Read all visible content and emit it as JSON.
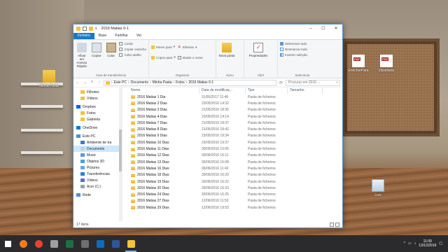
{
  "desktop": {
    "icons": [
      {
        "label": "Minha Pasta",
        "kind": "folder"
      },
      {
        "label": "EnricherPara",
        "kind": "pdf"
      },
      {
        "label": "Obsidiano",
        "kind": "pdf"
      },
      {
        "label": "Lixo",
        "kind": "bin"
      }
    ]
  },
  "window": {
    "title": "2016 Matias 0-1",
    "tabs": [
      "Ficheiro",
      "Base",
      "Partilhar",
      "Ver"
    ],
    "ribbon": {
      "clipboard": {
        "pin_label": "Afixar em Acesso Rápido",
        "copy_label": "Copiar",
        "paste_label": "Colar",
        "cut_label": "Cortar",
        "copy_path_label": "Copiar caminho",
        "paste_shortcut_label": "Colar atalho",
        "group_label": "Área de transferência"
      },
      "organize": {
        "move_label": "Mover para",
        "copy_to_label": "Copiar para",
        "delete_label": "Eliminar",
        "rename_label": "Mudar o nome",
        "group_label": "Organizar"
      },
      "new": {
        "new_folder_label": "Nova pasta",
        "group_label": "Novo"
      },
      "open": {
        "properties_label": "Propriedades",
        "group_label": "Abrir"
      },
      "select": {
        "select_all_label": "Selecionar tudo",
        "select_none_label": "Desmarcar tudo",
        "invert_label": "Inverter seleção",
        "group_label": "Selecionar"
      }
    },
    "breadcrumb": [
      "Este PC",
      "Documents",
      "Minha Pasta",
      "Fotos",
      "2016 Matias 0-1"
    ],
    "search_placeholder": "Procurar em 2016 ...",
    "nav": [
      {
        "label": "Filhotes",
        "icon": "folder-icon",
        "selected": false
      },
      {
        "label": "Vídeos",
        "icon": "folder-icon",
        "selected": false
      },
      {
        "label": "Dropbox",
        "icon": "dropbox-icon",
        "selected": false
      },
      {
        "label": "Fotos",
        "icon": "folder-icon",
        "selected": false
      },
      {
        "label": "Gabriela",
        "icon": "folder-icon",
        "selected": false
      },
      {
        "label": "OneDrive",
        "icon": "onedrive-icon",
        "selected": false
      },
      {
        "label": "Este PC",
        "icon": "pc-icon",
        "selected": false
      },
      {
        "label": "Ambiente de tra",
        "icon": "desktop-icon",
        "selected": false
      },
      {
        "label": "Documents",
        "icon": "documents-icon",
        "selected": true
      },
      {
        "label": "Music",
        "icon": "music-icon",
        "selected": false
      },
      {
        "label": "Objetos 3D",
        "icon": "objects3d-icon",
        "selected": false
      },
      {
        "label": "Pictures",
        "icon": "pictures-icon",
        "selected": false
      },
      {
        "label": "Transferências",
        "icon": "download-icon",
        "selected": false
      },
      {
        "label": "Vídeos",
        "icon": "videos-icon",
        "selected": false
      },
      {
        "label": "Acer (C:)",
        "icon": "drive-icon",
        "selected": false
      },
      {
        "label": "Rede",
        "icon": "network-icon",
        "selected": false
      }
    ],
    "columns": [
      "Nome",
      "Data de modificaç...",
      "Tipo",
      "Tamanho"
    ],
    "files": [
      {
        "name": "2016 Matias 1 Dia",
        "date": "11/05/2017 11:46",
        "type": "Pasta de ficheiros"
      },
      {
        "name": "2016 Matias 2 Dias",
        "date": "23/05/2016 14:32",
        "type": "Pasta de ficheiros"
      },
      {
        "name": "2016 Matias 3 Dias",
        "date": "21/05/2016 18:35",
        "type": "Pasta de ficheiros"
      },
      {
        "name": "2016 Matias 4 Dias",
        "date": "23/05/2016 14:14",
        "type": "Pasta de ficheiros"
      },
      {
        "name": "2016 Matias 7 Dias",
        "date": "21/05/2016 18:37",
        "type": "Pasta de ficheiros"
      },
      {
        "name": "2016 Matias 8 Dias",
        "date": "21/05/2016 18:42",
        "type": "Pasta de ficheiros"
      },
      {
        "name": "2016 Matias 9 Dias",
        "date": "23/05/2016 19:34",
        "type": "Pasta de ficheiros"
      },
      {
        "name": "2016 Matias 10 Dias",
        "date": "23/05/2016 19:37",
        "type": "Pasta de ficheiros"
      },
      {
        "name": "2016 Matias 11 Dias",
        "date": "30/05/2016 15:05",
        "type": "Pasta de ficheiros"
      },
      {
        "name": "2016 Matias 12 Dias",
        "date": "30/06/2016 16:11",
        "type": "Pasta de ficheiros"
      },
      {
        "name": "2016 Matias 13 Dias",
        "date": "30/05/2016 15:08",
        "type": "Pasta de ficheiros"
      },
      {
        "name": "2016 Matias 16 Dias",
        "date": "06/06/2016 11:42",
        "type": "Pasta de ficheiros"
      },
      {
        "name": "2016 Matias 18 Dias",
        "date": "30/06/2016 16:20",
        "type": "Pasta de ficheiros"
      },
      {
        "name": "2016 Matias 19 Dias",
        "date": "30/06/2016 16:22",
        "type": "Pasta de ficheiros"
      },
      {
        "name": "2016 Matias 20 Dias",
        "date": "30/06/2016 16:23",
        "type": "Pasta de ficheiros"
      },
      {
        "name": "2016 Matias 24 Dias",
        "date": "30/06/2016 16:25",
        "type": "Pasta de ficheiros"
      },
      {
        "name": "2016 Matias 27 Dias",
        "date": "12/06/2016 11:52",
        "type": "Pasta de ficheiros"
      },
      {
        "name": "2016 Matias 29 Dias",
        "date": "12/06/2016 19:53",
        "type": "Pasta de ficheiros"
      }
    ],
    "status": "17 itens"
  },
  "taskbar": {
    "apps": [
      {
        "name": "windows-start-icon",
        "color": "#ffffff",
        "active": false
      },
      {
        "name": "firefox-icon",
        "color": "#ff7a1a",
        "active": false
      },
      {
        "name": "chrome-icon",
        "color": "#e94235",
        "active": false
      },
      {
        "name": "calculator-icon",
        "color": "#9e9e9e",
        "active": false
      },
      {
        "name": "excel-icon",
        "color": "#1d6f42",
        "active": false
      },
      {
        "name": "media-icon",
        "color": "#6e6e6e",
        "active": false
      },
      {
        "name": "outlook-icon",
        "color": "#0f6cbd",
        "active": false
      },
      {
        "name": "word-icon",
        "color": "#2b579a",
        "active": false
      },
      {
        "name": "file-explorer-icon",
        "color": "#f3c33b",
        "active": true
      }
    ],
    "time": "11:09",
    "date": "13/12/2019"
  },
  "colors": {
    "accent": "#1979ca",
    "selection": "#cce8ff",
    "taskbar": "#2b2b2e"
  }
}
